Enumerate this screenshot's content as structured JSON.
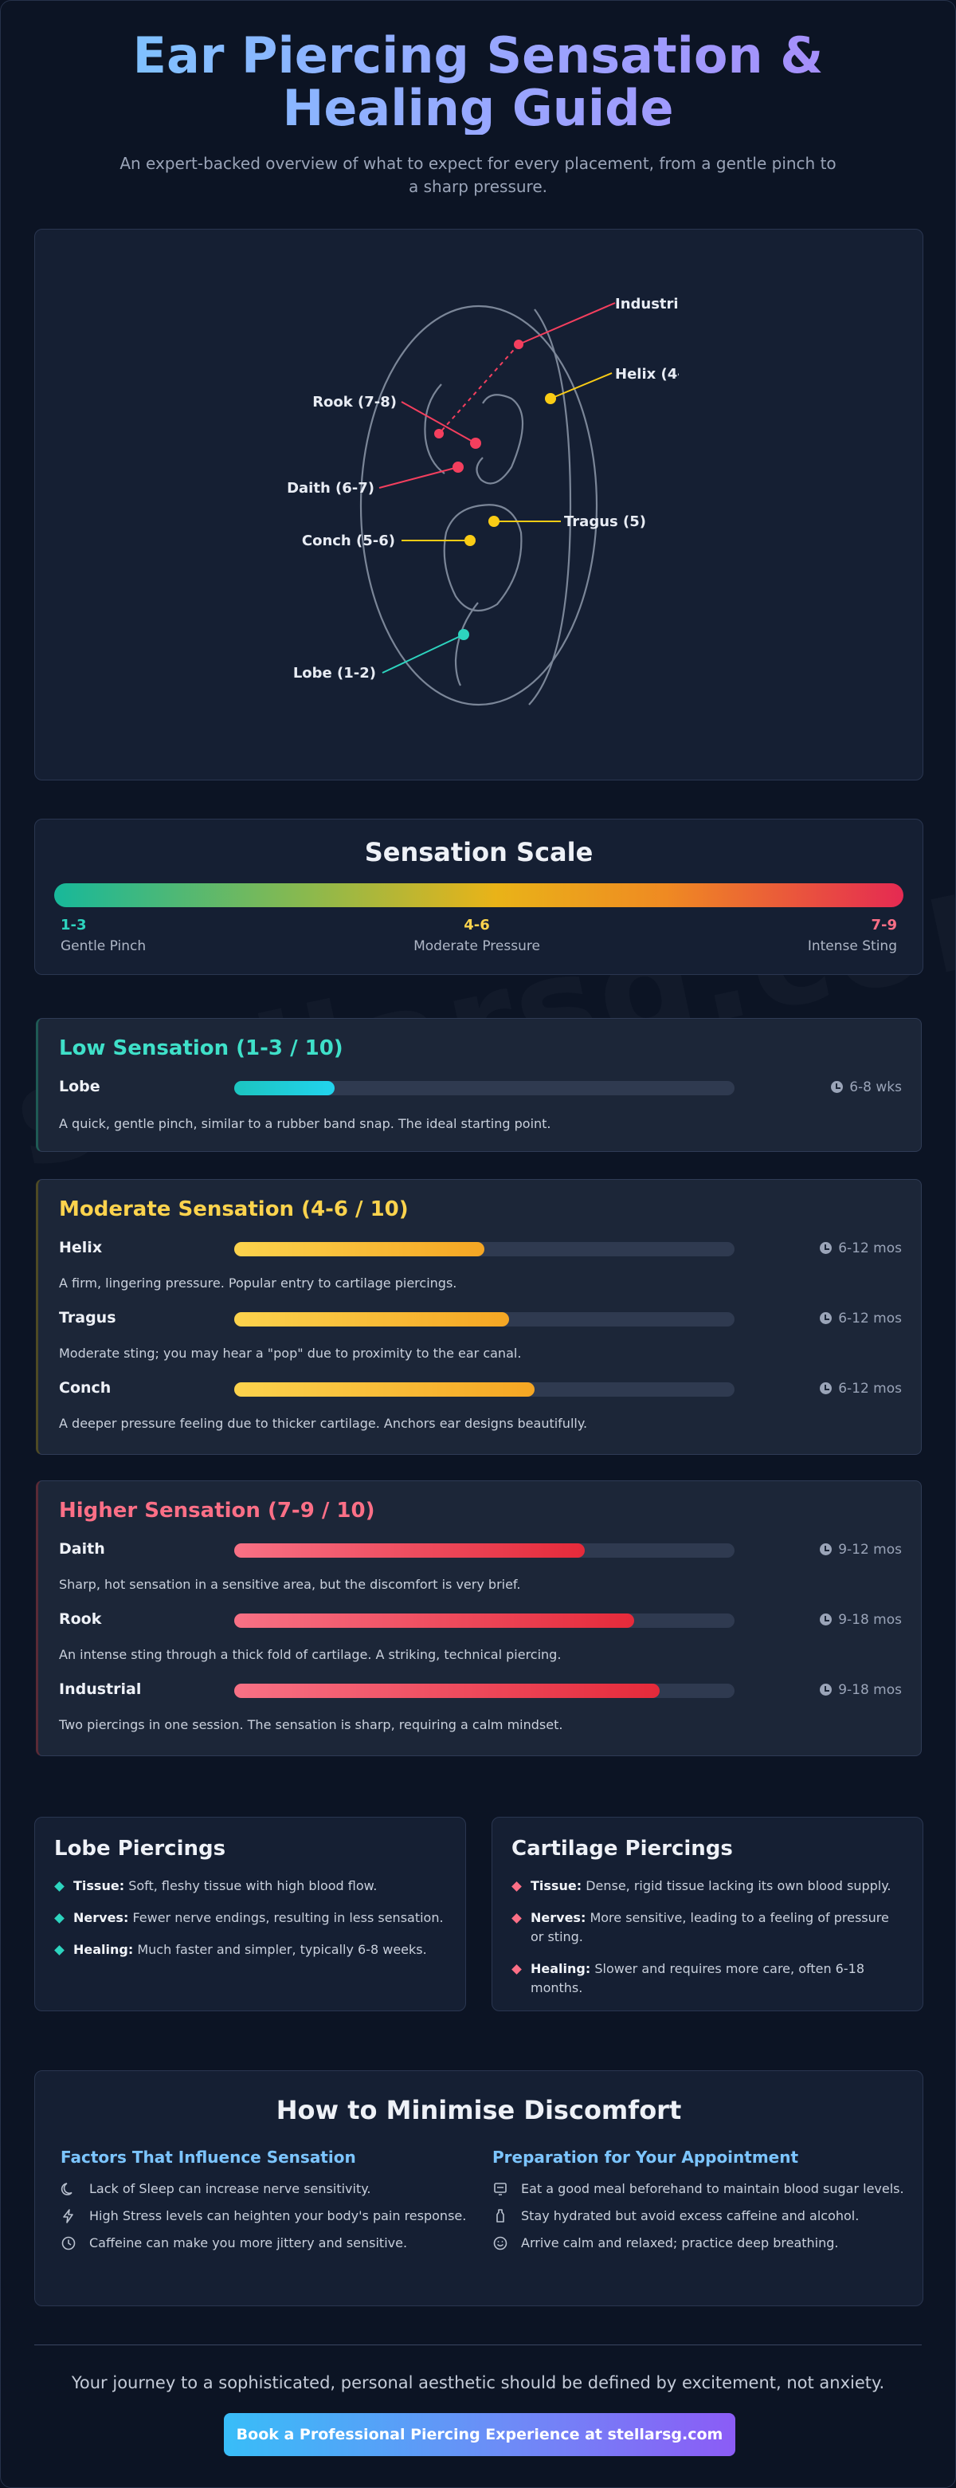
{
  "header": {
    "title": "Ear Piercing Sensation & Healing Guide",
    "subtitle": "An expert-backed overview of what to expect for every placement, from a gentle pinch to a sharp pressure."
  },
  "watermark": "stellarsg.com",
  "diagram": {
    "labels": {
      "industrial": "Industri",
      "helix": "Helix (4-",
      "rook": "Rook (7-8)",
      "daith": "Daith (6-7)",
      "tragus": "Tragus (5)",
      "conch": "Conch (5-6)",
      "lobe": "Lobe (1-2)"
    },
    "colors": {
      "low": "#2dd4bf",
      "moderate": "#facc15",
      "high": "#f43f5e"
    }
  },
  "scale": {
    "title": "Sensation Scale",
    "low": {
      "range": "1-3",
      "label": "Gentle Pinch",
      "color": "#2dd4bf"
    },
    "mid": {
      "range": "4-6",
      "label": "Moderate Pressure",
      "color": "#fcd34d"
    },
    "high": {
      "range": "7-9",
      "label": "Intense Sting",
      "color": "#fb6f86"
    }
  },
  "groups": {
    "low": {
      "title": "Low Sensation (1-3 / 10)",
      "items": [
        {
          "name": "Lobe",
          "level": 0.2,
          "time": "6-8 wks",
          "desc": "A quick, gentle pinch, similar to a rubber band snap. The ideal starting point."
        }
      ]
    },
    "moderate": {
      "title": "Moderate Sensation (4-6 / 10)",
      "items": [
        {
          "name": "Helix",
          "level": 0.5,
          "time": "6-12 mos",
          "desc": "A firm, lingering pressure. Popular entry to cartilage piercings."
        },
        {
          "name": "Tragus",
          "level": 0.55,
          "time": "6-12 mos",
          "desc": "Moderate sting; you may hear a \"pop\" due to proximity to the ear canal."
        },
        {
          "name": "Conch",
          "level": 0.6,
          "time": "6-12 mos",
          "desc": "A deeper pressure feeling due to thicker cartilage. Anchors ear designs beautifully."
        }
      ]
    },
    "high": {
      "title": "Higher Sensation (7-9 / 10)",
      "items": [
        {
          "name": "Daith",
          "level": 0.7,
          "time": "9-12 mos",
          "desc": "Sharp, hot sensation in a sensitive area, but the discomfort is very brief."
        },
        {
          "name": "Rook",
          "level": 0.8,
          "time": "9-18 mos",
          "desc": "An intense sting through a thick fold of cartilage. A striking, technical piercing."
        },
        {
          "name": "Industrial",
          "level": 0.85,
          "time": "9-18 mos",
          "desc": "Two piercings in one session. The sensation is sharp, requiring a calm mindset."
        }
      ]
    }
  },
  "tissue": {
    "lobe": {
      "title": "Lobe Piercings",
      "points": [
        {
          "key": "Tissue:",
          "text": "Soft, fleshy tissue with high blood flow."
        },
        {
          "key": "Nerves:",
          "text": "Fewer nerve endings, resulting in less sensation."
        },
        {
          "key": "Healing:",
          "text": "Much faster and simpler, typically 6-8 weeks."
        }
      ]
    },
    "cartilage": {
      "title": "Cartilage Piercings",
      "points": [
        {
          "key": "Tissue:",
          "text": "Dense, rigid tissue lacking its own blood supply."
        },
        {
          "key": "Nerves:",
          "text": "More sensitive, leading to a feeling of pressure or sting."
        },
        {
          "key": "Healing:",
          "text": "Slower and requires more care, often 6-18 months."
        }
      ]
    }
  },
  "tips": {
    "title": "How to Minimise Discomfort",
    "factors": {
      "heading": "Factors That Influence Sensation",
      "items": [
        {
          "icon": "moon-icon",
          "text": "Lack of Sleep can increase nerve sensitivity."
        },
        {
          "icon": "lightning-icon",
          "text": "High Stress levels can heighten your body's pain response."
        },
        {
          "icon": "clock-icon",
          "text": "Caffeine can make you more jittery and sensitive."
        }
      ]
    },
    "prep": {
      "heading": "Preparation for Your Appointment",
      "items": [
        {
          "icon": "meal-icon",
          "text": "Eat a good meal beforehand to maintain blood sugar levels."
        },
        {
          "icon": "bottle-icon",
          "text": "Stay hydrated but avoid excess caffeine and alcohol."
        },
        {
          "icon": "smile-icon",
          "text": "Arrive calm and relaxed; practice deep breathing."
        }
      ]
    }
  },
  "footer": {
    "closing": "Your journey to a sophisticated, personal aesthetic should be defined by excitement, not anxiety.",
    "cta": "Book a Professional Piercing Experience at stellarsg.com"
  }
}
